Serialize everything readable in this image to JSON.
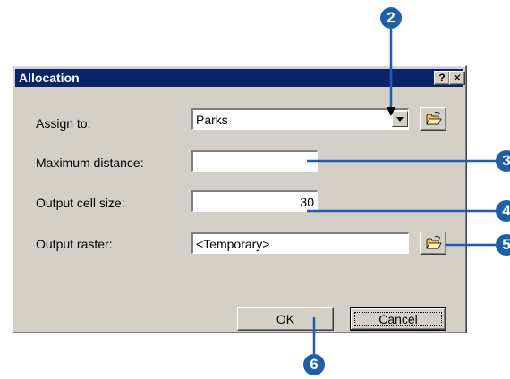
{
  "dialog": {
    "title": "Allocation",
    "help_button": "?",
    "close_button": "✕"
  },
  "form": {
    "assign_to": {
      "label": "Assign to:",
      "value": "Parks"
    },
    "maximum_distance": {
      "label": "Maximum distance:",
      "value": ""
    },
    "output_cell_size": {
      "label": "Output cell size:",
      "value": "30"
    },
    "output_raster": {
      "label": "Output raster:",
      "value": "<Temporary>"
    }
  },
  "buttons": {
    "ok": "OK",
    "cancel": "Cancel"
  },
  "callouts": {
    "c2": "2",
    "c3": "3",
    "c4": "4",
    "c5": "5",
    "c6": "6"
  },
  "colors": {
    "title_bar": "#0a246a",
    "dialog_face": "#d4d0c8",
    "callout": "#1f5ea8"
  },
  "icons": {
    "dropdown": "chevron-down-icon",
    "browse": "open-folder-icon"
  }
}
